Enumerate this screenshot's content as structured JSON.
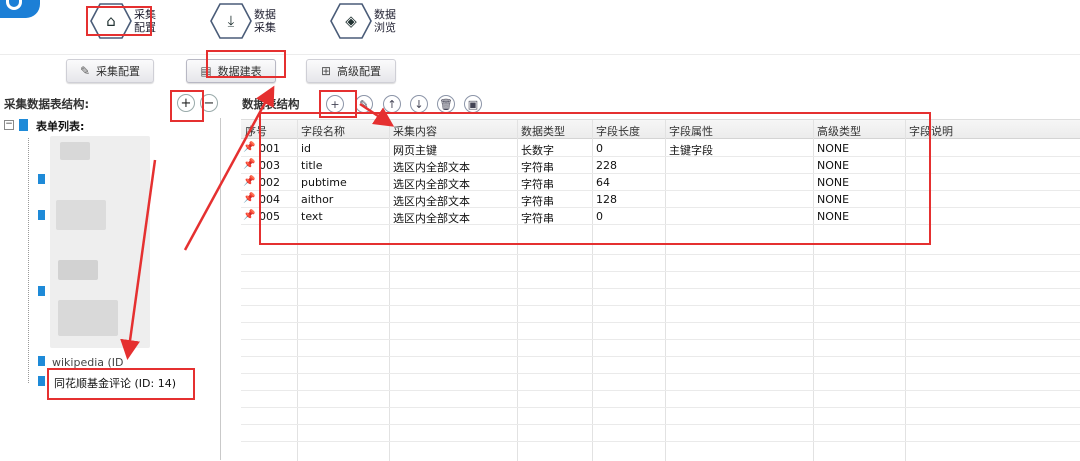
{
  "topnav": [
    {
      "id": "collect-config",
      "label": "采集配置",
      "icon": "home-icon"
    },
    {
      "id": "data-collect",
      "label": "数据采集",
      "icon": "download-icon"
    },
    {
      "id": "data-browse",
      "label": "数据浏览",
      "icon": "layers-icon"
    }
  ],
  "subnav": [
    {
      "id": "collect-config",
      "label": "采集配置",
      "icon": "edit-icon"
    },
    {
      "id": "table-build",
      "label": "数据建表",
      "icon": "document-icon",
      "active": true
    },
    {
      "id": "advanced-config",
      "label": "高级配置",
      "icon": "grid-icon"
    }
  ],
  "left": {
    "title": "采集数据表结构:",
    "tree_root": "表单列表:",
    "partial_item": "wikipedia (ID",
    "selected_item": "同花顺基金评论 (ID: 14)"
  },
  "right": {
    "title": "数据表结构"
  },
  "table": {
    "columns": [
      "序号",
      "字段名称",
      "采集内容",
      "数据类型",
      "字段长度",
      "字段属性",
      "高级类型",
      "字段说明"
    ],
    "rows": [
      {
        "num": "001",
        "name": "id",
        "content": "网页主键",
        "type": "长数字",
        "length": "0",
        "attr": "主键字段",
        "adv": "NONE",
        "desc": ""
      },
      {
        "num": "003",
        "name": "title",
        "content": "选区内全部文本",
        "type": "字符串",
        "length": "228",
        "attr": "",
        "adv": "NONE",
        "desc": ""
      },
      {
        "num": "002",
        "name": "pubtime",
        "content": "选区内全部文本",
        "type": "字符串",
        "length": "64",
        "attr": "",
        "adv": "NONE",
        "desc": ""
      },
      {
        "num": "004",
        "name": "aithor",
        "content": "选区内全部文本",
        "type": "字符串",
        "length": "128",
        "attr": "",
        "adv": "NONE",
        "desc": ""
      },
      {
        "num": "005",
        "name": "text",
        "content": "选区内全部文本",
        "type": "字符串",
        "length": "0",
        "attr": "",
        "adv": "NONE",
        "desc": ""
      }
    ]
  },
  "colors": {
    "accent": "#1c7fd6",
    "annotation": "#e53030"
  }
}
